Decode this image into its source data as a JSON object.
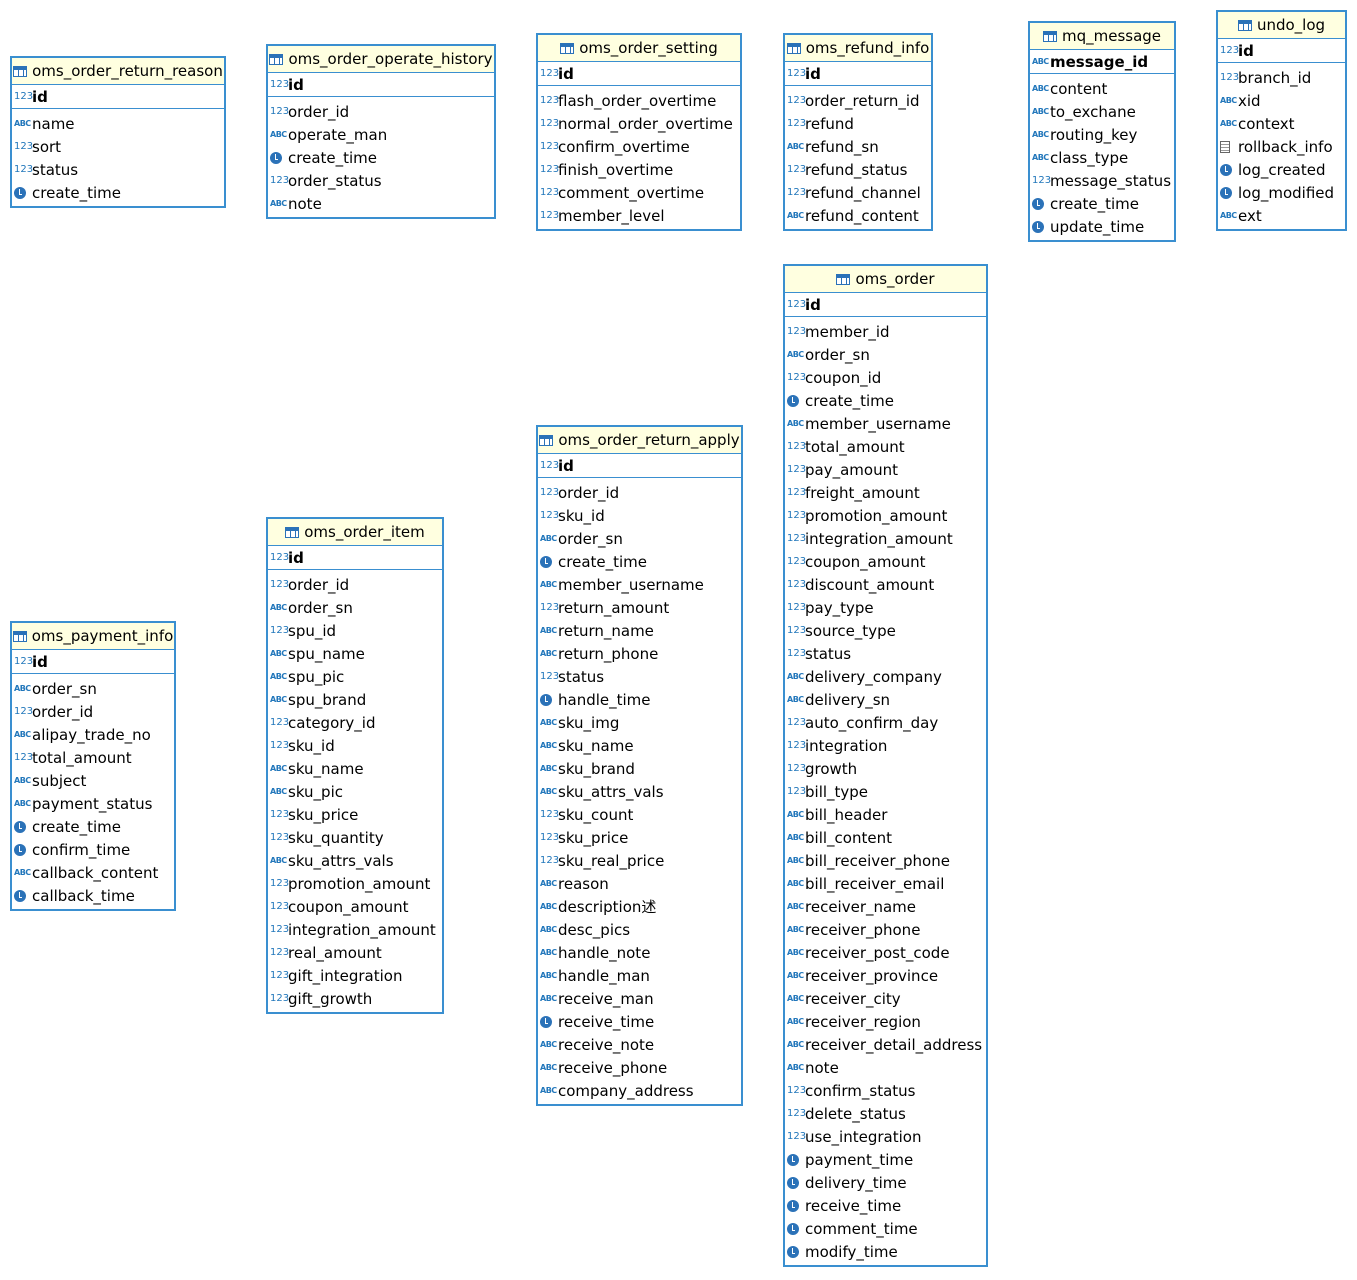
{
  "tables": [
    {
      "key": "t1",
      "name": "oms_order_return_reason",
      "pk": {
        "type": "num",
        "name": "id"
      },
      "cols": [
        {
          "type": "abc",
          "name": "name"
        },
        {
          "type": "num",
          "name": "sort"
        },
        {
          "type": "num",
          "name": "status"
        },
        {
          "type": "time",
          "name": "create_time"
        }
      ]
    },
    {
      "key": "t2",
      "name": "oms_order_operate_history",
      "pk": {
        "type": "num",
        "name": "id"
      },
      "cols": [
        {
          "type": "num",
          "name": "order_id"
        },
        {
          "type": "abc",
          "name": "operate_man"
        },
        {
          "type": "time",
          "name": "create_time"
        },
        {
          "type": "num",
          "name": "order_status"
        },
        {
          "type": "abc",
          "name": "note"
        }
      ]
    },
    {
      "key": "t3",
      "name": "oms_order_setting",
      "pk": {
        "type": "num",
        "name": "id"
      },
      "cols": [
        {
          "type": "num",
          "name": "flash_order_overtime"
        },
        {
          "type": "num",
          "name": "normal_order_overtime"
        },
        {
          "type": "num",
          "name": "confirm_overtime"
        },
        {
          "type": "num",
          "name": "finish_overtime"
        },
        {
          "type": "num",
          "name": "comment_overtime"
        },
        {
          "type": "num",
          "name": "member_level"
        }
      ]
    },
    {
      "key": "t4",
      "name": "oms_refund_info",
      "pk": {
        "type": "num",
        "name": "id"
      },
      "cols": [
        {
          "type": "num",
          "name": "order_return_id"
        },
        {
          "type": "num",
          "name": "refund"
        },
        {
          "type": "abc",
          "name": "refund_sn"
        },
        {
          "type": "num",
          "name": "refund_status"
        },
        {
          "type": "num",
          "name": "refund_channel"
        },
        {
          "type": "abc",
          "name": "refund_content"
        }
      ]
    },
    {
      "key": "t5",
      "name": "mq_message",
      "pk": {
        "type": "abc",
        "name": "message_id"
      },
      "cols": [
        {
          "type": "abc",
          "name": "content"
        },
        {
          "type": "abc",
          "name": "to_exchane"
        },
        {
          "type": "abc",
          "name": "routing_key"
        },
        {
          "type": "abc",
          "name": "class_type"
        },
        {
          "type": "num",
          "name": "message_status"
        },
        {
          "type": "time",
          "name": "create_time"
        },
        {
          "type": "time",
          "name": "update_time"
        }
      ]
    },
    {
      "key": "t6",
      "name": "undo_log",
      "pk": {
        "type": "num",
        "name": "id"
      },
      "cols": [
        {
          "type": "num",
          "name": "branch_id"
        },
        {
          "type": "abc",
          "name": "xid"
        },
        {
          "type": "abc",
          "name": "context"
        },
        {
          "type": "doc",
          "name": "rollback_info"
        },
        {
          "type": "time",
          "name": "log_created"
        },
        {
          "type": "time",
          "name": "log_modified"
        },
        {
          "type": "abc",
          "name": "ext"
        }
      ]
    },
    {
      "key": "t7",
      "name": "oms_order",
      "pk": {
        "type": "num",
        "name": "id"
      },
      "cols": [
        {
          "type": "num",
          "name": "member_id"
        },
        {
          "type": "abc",
          "name": "order_sn"
        },
        {
          "type": "num",
          "name": "coupon_id"
        },
        {
          "type": "time",
          "name": "create_time"
        },
        {
          "type": "abc",
          "name": "member_username"
        },
        {
          "type": "num",
          "name": "total_amount"
        },
        {
          "type": "num",
          "name": "pay_amount"
        },
        {
          "type": "num",
          "name": "freight_amount"
        },
        {
          "type": "num",
          "name": "promotion_amount"
        },
        {
          "type": "num",
          "name": "integration_amount"
        },
        {
          "type": "num",
          "name": "coupon_amount"
        },
        {
          "type": "num",
          "name": "discount_amount"
        },
        {
          "type": "num",
          "name": "pay_type"
        },
        {
          "type": "num",
          "name": "source_type"
        },
        {
          "type": "num",
          "name": "status"
        },
        {
          "type": "abc",
          "name": "delivery_company"
        },
        {
          "type": "abc",
          "name": "delivery_sn"
        },
        {
          "type": "num",
          "name": "auto_confirm_day"
        },
        {
          "type": "num",
          "name": "integration"
        },
        {
          "type": "num",
          "name": "growth"
        },
        {
          "type": "num",
          "name": "bill_type"
        },
        {
          "type": "abc",
          "name": "bill_header"
        },
        {
          "type": "abc",
          "name": "bill_content"
        },
        {
          "type": "abc",
          "name": "bill_receiver_phone"
        },
        {
          "type": "abc",
          "name": "bill_receiver_email"
        },
        {
          "type": "abc",
          "name": "receiver_name"
        },
        {
          "type": "abc",
          "name": "receiver_phone"
        },
        {
          "type": "abc",
          "name": "receiver_post_code"
        },
        {
          "type": "abc",
          "name": "receiver_province"
        },
        {
          "type": "abc",
          "name": "receiver_city"
        },
        {
          "type": "abc",
          "name": "receiver_region"
        },
        {
          "type": "abc",
          "name": "receiver_detail_address"
        },
        {
          "type": "abc",
          "name": "note"
        },
        {
          "type": "num",
          "name": "confirm_status"
        },
        {
          "type": "num",
          "name": "delete_status"
        },
        {
          "type": "num",
          "name": "use_integration"
        },
        {
          "type": "time",
          "name": "payment_time"
        },
        {
          "type": "time",
          "name": "delivery_time"
        },
        {
          "type": "time",
          "name": "receive_time"
        },
        {
          "type": "time",
          "name": "comment_time"
        },
        {
          "type": "time",
          "name": "modify_time"
        }
      ]
    },
    {
      "key": "t8",
      "name": "oms_order_return_apply",
      "pk": {
        "type": "num",
        "name": "id"
      },
      "cols": [
        {
          "type": "num",
          "name": "order_id"
        },
        {
          "type": "num",
          "name": "sku_id"
        },
        {
          "type": "abc",
          "name": "order_sn"
        },
        {
          "type": "time",
          "name": "create_time"
        },
        {
          "type": "abc",
          "name": "member_username"
        },
        {
          "type": "num",
          "name": "return_amount"
        },
        {
          "type": "abc",
          "name": "return_name"
        },
        {
          "type": "abc",
          "name": "return_phone"
        },
        {
          "type": "num",
          "name": "status"
        },
        {
          "type": "time",
          "name": "handle_time"
        },
        {
          "type": "abc",
          "name": "sku_img"
        },
        {
          "type": "abc",
          "name": "sku_name"
        },
        {
          "type": "abc",
          "name": "sku_brand"
        },
        {
          "type": "abc",
          "name": "sku_attrs_vals"
        },
        {
          "type": "num",
          "name": "sku_count"
        },
        {
          "type": "num",
          "name": "sku_price"
        },
        {
          "type": "num",
          "name": "sku_real_price"
        },
        {
          "type": "abc",
          "name": "reason"
        },
        {
          "type": "abc",
          "name": "description述"
        },
        {
          "type": "abc",
          "name": "desc_pics"
        },
        {
          "type": "abc",
          "name": "handle_note"
        },
        {
          "type": "abc",
          "name": "handle_man"
        },
        {
          "type": "abc",
          "name": "receive_man"
        },
        {
          "type": "time",
          "name": "receive_time"
        },
        {
          "type": "abc",
          "name": "receive_note"
        },
        {
          "type": "abc",
          "name": "receive_phone"
        },
        {
          "type": "abc",
          "name": "company_address"
        }
      ]
    },
    {
      "key": "t9",
      "name": "oms_order_item",
      "pk": {
        "type": "num",
        "name": "id"
      },
      "cols": [
        {
          "type": "num",
          "name": "order_id"
        },
        {
          "type": "abc",
          "name": "order_sn"
        },
        {
          "type": "num",
          "name": "spu_id"
        },
        {
          "type": "abc",
          "name": "spu_name"
        },
        {
          "type": "abc",
          "name": "spu_pic"
        },
        {
          "type": "abc",
          "name": "spu_brand"
        },
        {
          "type": "num",
          "name": "category_id"
        },
        {
          "type": "num",
          "name": "sku_id"
        },
        {
          "type": "abc",
          "name": "sku_name"
        },
        {
          "type": "abc",
          "name": "sku_pic"
        },
        {
          "type": "num",
          "name": "sku_price"
        },
        {
          "type": "num",
          "name": "sku_quantity"
        },
        {
          "type": "abc",
          "name": "sku_attrs_vals"
        },
        {
          "type": "num",
          "name": "promotion_amount"
        },
        {
          "type": "num",
          "name": "coupon_amount"
        },
        {
          "type": "num",
          "name": "integration_amount"
        },
        {
          "type": "num",
          "name": "real_amount"
        },
        {
          "type": "num",
          "name": "gift_integration"
        },
        {
          "type": "num",
          "name": "gift_growth"
        }
      ]
    },
    {
      "key": "t10",
      "name": "oms_payment_info",
      "pk": {
        "type": "num",
        "name": "id"
      },
      "cols": [
        {
          "type": "abc",
          "name": "order_sn"
        },
        {
          "type": "num",
          "name": "order_id"
        },
        {
          "type": "abc",
          "name": "alipay_trade_no"
        },
        {
          "type": "num",
          "name": "total_amount"
        },
        {
          "type": "abc",
          "name": "subject"
        },
        {
          "type": "abc",
          "name": "payment_status"
        },
        {
          "type": "time",
          "name": "create_time"
        },
        {
          "type": "time",
          "name": "confirm_time"
        },
        {
          "type": "abc",
          "name": "callback_content"
        },
        {
          "type": "time",
          "name": "callback_time"
        }
      ]
    }
  ]
}
